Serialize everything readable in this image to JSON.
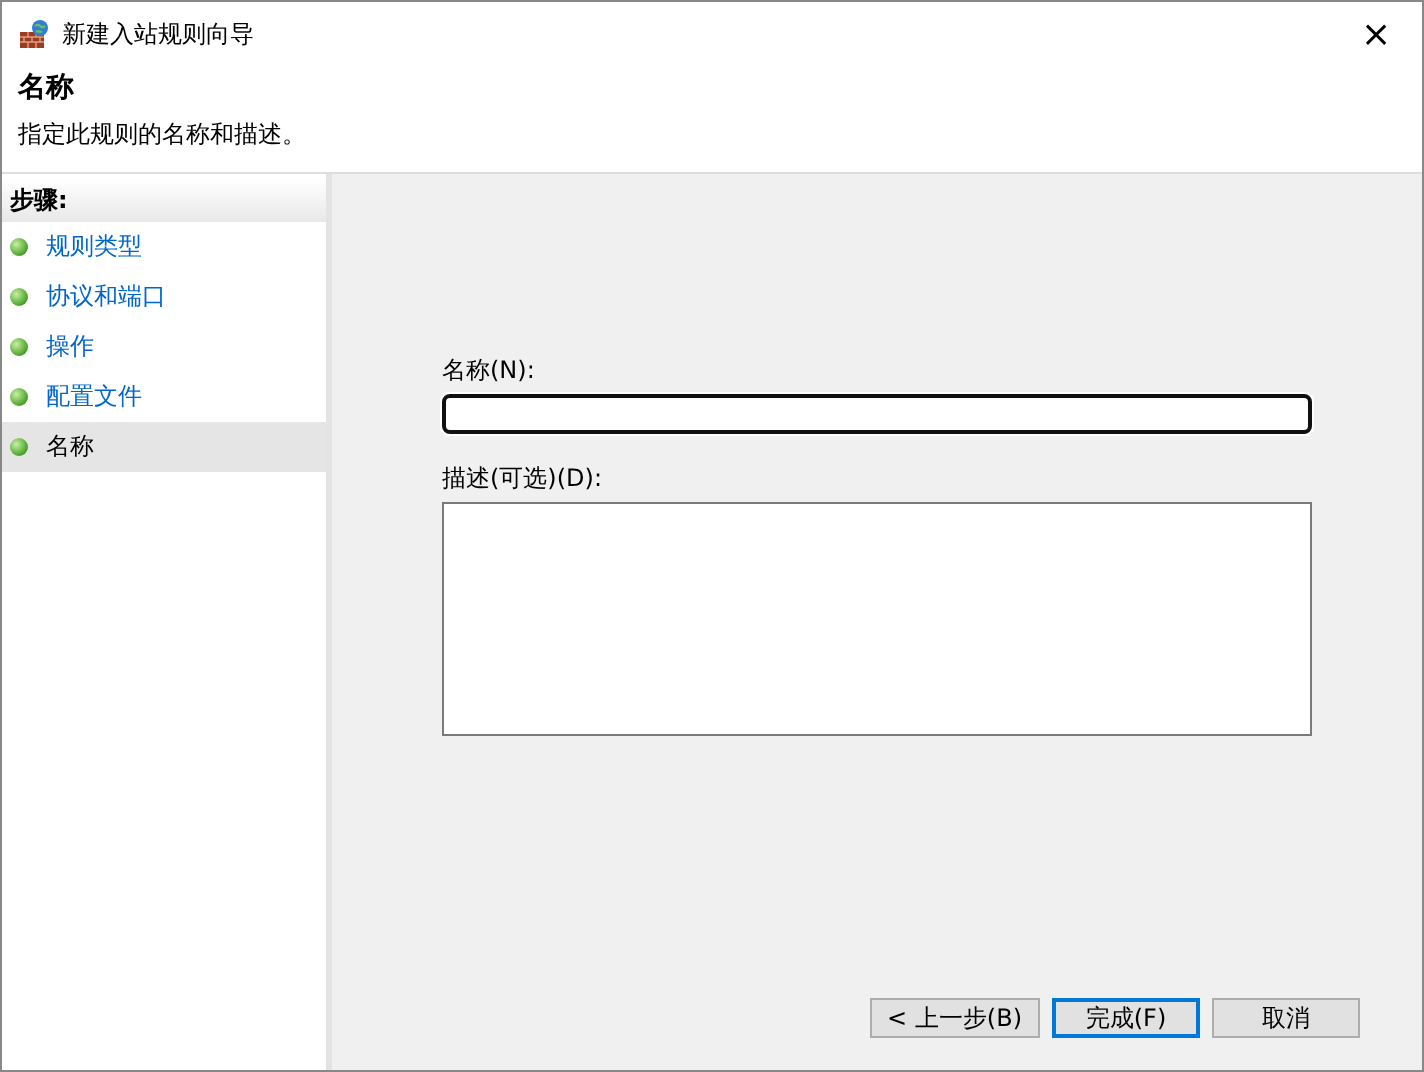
{
  "window": {
    "title": "新建入站规则向导",
    "close": "×"
  },
  "header": {
    "title": "名称",
    "subtitle": "指定此规则的名称和描述。"
  },
  "steps": {
    "heading": "步骤:",
    "items": [
      {
        "label": "规则类型",
        "selected": false
      },
      {
        "label": "协议和端口",
        "selected": false
      },
      {
        "label": "操作",
        "selected": false
      },
      {
        "label": "配置文件",
        "selected": false
      },
      {
        "label": "名称",
        "selected": true
      }
    ]
  },
  "form": {
    "name_label": "名称(N):",
    "description_label": "描述(可选)(D):"
  },
  "buttons": [
    {
      "label": "< 上一步(B)",
      "default": false
    },
    {
      "label": "完成(F)",
      "default": true
    },
    {
      "label": "取消",
      "default": false
    }
  ]
}
